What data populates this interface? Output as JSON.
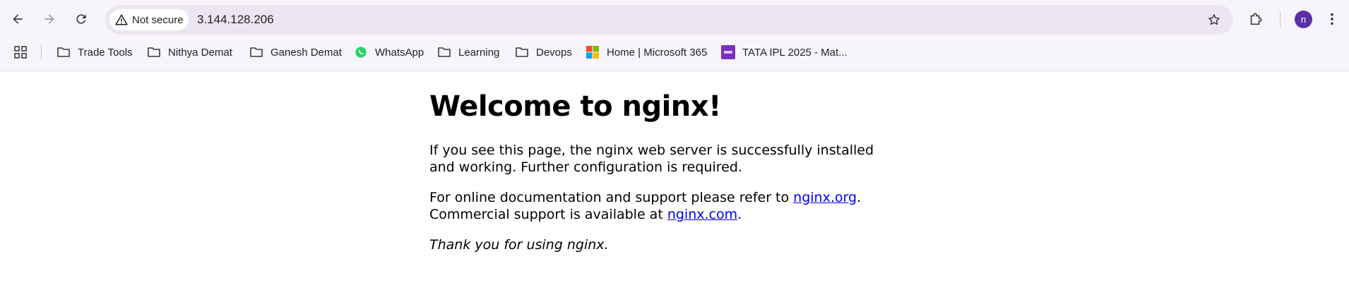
{
  "browser": {
    "security_label": "Not secure",
    "url": "3.144.128.206",
    "profile_initial": "n",
    "colors": {
      "chrome_bg": "#f8f4fc",
      "omnibox_bg": "#ece6f2",
      "avatar": "#5b2ea6",
      "link": "#0000ee"
    }
  },
  "bookmarks": [
    {
      "label": "Trade Tools",
      "icon": "folder-icon"
    },
    {
      "label": "Nithya Demat",
      "icon": "folder-icon"
    },
    {
      "label": "Ganesh Demat",
      "icon": "folder-icon"
    },
    {
      "label": "WhatsApp",
      "icon": "whatsapp-icon"
    },
    {
      "label": "Learning",
      "icon": "folder-icon"
    },
    {
      "label": "Devops",
      "icon": "folder-icon"
    },
    {
      "label": "Home | Microsoft 365",
      "icon": "microsoft-icon"
    },
    {
      "label": "TATA IPL 2025 - Mat...",
      "icon": "dream11-icon"
    }
  ],
  "page": {
    "title": "Welcome to nginx!",
    "p1": "If you see this page, the nginx web server is successfully installed and working. Further configuration is required.",
    "p2_prefix": "For online documentation and support please refer to ",
    "p2_link": "nginx.org",
    "p2_mid": ".",
    "p2_line2_prefix": "Commercial support is available at ",
    "p2_link2": "nginx.com",
    "p2_end": ".",
    "p3": "Thank you for using nginx."
  }
}
